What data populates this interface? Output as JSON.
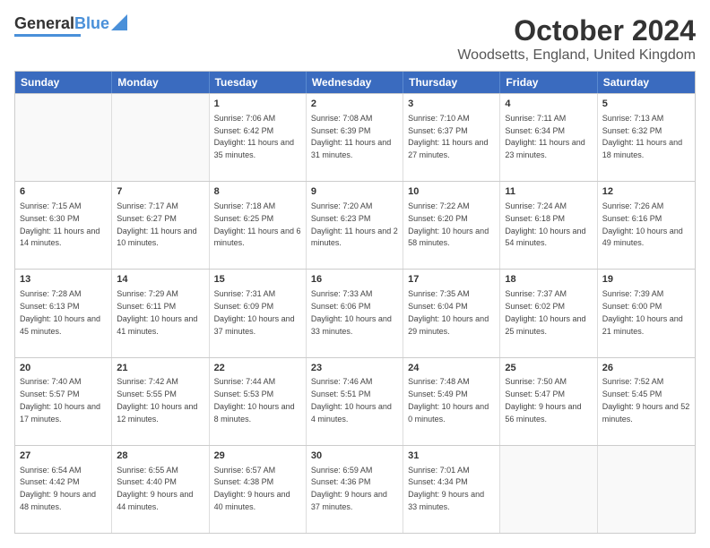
{
  "header": {
    "logo_general": "General",
    "logo_blue": "Blue",
    "title": "October 2024",
    "subtitle": "Woodsetts, England, United Kingdom"
  },
  "days_of_week": [
    "Sunday",
    "Monday",
    "Tuesday",
    "Wednesday",
    "Thursday",
    "Friday",
    "Saturday"
  ],
  "weeks": [
    [
      {
        "day": "",
        "sunrise": "",
        "sunset": "",
        "daylight": ""
      },
      {
        "day": "",
        "sunrise": "",
        "sunset": "",
        "daylight": ""
      },
      {
        "day": "1",
        "sunrise": "Sunrise: 7:06 AM",
        "sunset": "Sunset: 6:42 PM",
        "daylight": "Daylight: 11 hours and 35 minutes."
      },
      {
        "day": "2",
        "sunrise": "Sunrise: 7:08 AM",
        "sunset": "Sunset: 6:39 PM",
        "daylight": "Daylight: 11 hours and 31 minutes."
      },
      {
        "day": "3",
        "sunrise": "Sunrise: 7:10 AM",
        "sunset": "Sunset: 6:37 PM",
        "daylight": "Daylight: 11 hours and 27 minutes."
      },
      {
        "day": "4",
        "sunrise": "Sunrise: 7:11 AM",
        "sunset": "Sunset: 6:34 PM",
        "daylight": "Daylight: 11 hours and 23 minutes."
      },
      {
        "day": "5",
        "sunrise": "Sunrise: 7:13 AM",
        "sunset": "Sunset: 6:32 PM",
        "daylight": "Daylight: 11 hours and 18 minutes."
      }
    ],
    [
      {
        "day": "6",
        "sunrise": "Sunrise: 7:15 AM",
        "sunset": "Sunset: 6:30 PM",
        "daylight": "Daylight: 11 hours and 14 minutes."
      },
      {
        "day": "7",
        "sunrise": "Sunrise: 7:17 AM",
        "sunset": "Sunset: 6:27 PM",
        "daylight": "Daylight: 11 hours and 10 minutes."
      },
      {
        "day": "8",
        "sunrise": "Sunrise: 7:18 AM",
        "sunset": "Sunset: 6:25 PM",
        "daylight": "Daylight: 11 hours and 6 minutes."
      },
      {
        "day": "9",
        "sunrise": "Sunrise: 7:20 AM",
        "sunset": "Sunset: 6:23 PM",
        "daylight": "Daylight: 11 hours and 2 minutes."
      },
      {
        "day": "10",
        "sunrise": "Sunrise: 7:22 AM",
        "sunset": "Sunset: 6:20 PM",
        "daylight": "Daylight: 10 hours and 58 minutes."
      },
      {
        "day": "11",
        "sunrise": "Sunrise: 7:24 AM",
        "sunset": "Sunset: 6:18 PM",
        "daylight": "Daylight: 10 hours and 54 minutes."
      },
      {
        "day": "12",
        "sunrise": "Sunrise: 7:26 AM",
        "sunset": "Sunset: 6:16 PM",
        "daylight": "Daylight: 10 hours and 49 minutes."
      }
    ],
    [
      {
        "day": "13",
        "sunrise": "Sunrise: 7:28 AM",
        "sunset": "Sunset: 6:13 PM",
        "daylight": "Daylight: 10 hours and 45 minutes."
      },
      {
        "day": "14",
        "sunrise": "Sunrise: 7:29 AM",
        "sunset": "Sunset: 6:11 PM",
        "daylight": "Daylight: 10 hours and 41 minutes."
      },
      {
        "day": "15",
        "sunrise": "Sunrise: 7:31 AM",
        "sunset": "Sunset: 6:09 PM",
        "daylight": "Daylight: 10 hours and 37 minutes."
      },
      {
        "day": "16",
        "sunrise": "Sunrise: 7:33 AM",
        "sunset": "Sunset: 6:06 PM",
        "daylight": "Daylight: 10 hours and 33 minutes."
      },
      {
        "day": "17",
        "sunrise": "Sunrise: 7:35 AM",
        "sunset": "Sunset: 6:04 PM",
        "daylight": "Daylight: 10 hours and 29 minutes."
      },
      {
        "day": "18",
        "sunrise": "Sunrise: 7:37 AM",
        "sunset": "Sunset: 6:02 PM",
        "daylight": "Daylight: 10 hours and 25 minutes."
      },
      {
        "day": "19",
        "sunrise": "Sunrise: 7:39 AM",
        "sunset": "Sunset: 6:00 PM",
        "daylight": "Daylight: 10 hours and 21 minutes."
      }
    ],
    [
      {
        "day": "20",
        "sunrise": "Sunrise: 7:40 AM",
        "sunset": "Sunset: 5:57 PM",
        "daylight": "Daylight: 10 hours and 17 minutes."
      },
      {
        "day": "21",
        "sunrise": "Sunrise: 7:42 AM",
        "sunset": "Sunset: 5:55 PM",
        "daylight": "Daylight: 10 hours and 12 minutes."
      },
      {
        "day": "22",
        "sunrise": "Sunrise: 7:44 AM",
        "sunset": "Sunset: 5:53 PM",
        "daylight": "Daylight: 10 hours and 8 minutes."
      },
      {
        "day": "23",
        "sunrise": "Sunrise: 7:46 AM",
        "sunset": "Sunset: 5:51 PM",
        "daylight": "Daylight: 10 hours and 4 minutes."
      },
      {
        "day": "24",
        "sunrise": "Sunrise: 7:48 AM",
        "sunset": "Sunset: 5:49 PM",
        "daylight": "Daylight: 10 hours and 0 minutes."
      },
      {
        "day": "25",
        "sunrise": "Sunrise: 7:50 AM",
        "sunset": "Sunset: 5:47 PM",
        "daylight": "Daylight: 9 hours and 56 minutes."
      },
      {
        "day": "26",
        "sunrise": "Sunrise: 7:52 AM",
        "sunset": "Sunset: 5:45 PM",
        "daylight": "Daylight: 9 hours and 52 minutes."
      }
    ],
    [
      {
        "day": "27",
        "sunrise": "Sunrise: 6:54 AM",
        "sunset": "Sunset: 4:42 PM",
        "daylight": "Daylight: 9 hours and 48 minutes."
      },
      {
        "day": "28",
        "sunrise": "Sunrise: 6:55 AM",
        "sunset": "Sunset: 4:40 PM",
        "daylight": "Daylight: 9 hours and 44 minutes."
      },
      {
        "day": "29",
        "sunrise": "Sunrise: 6:57 AM",
        "sunset": "Sunset: 4:38 PM",
        "daylight": "Daylight: 9 hours and 40 minutes."
      },
      {
        "day": "30",
        "sunrise": "Sunrise: 6:59 AM",
        "sunset": "Sunset: 4:36 PM",
        "daylight": "Daylight: 9 hours and 37 minutes."
      },
      {
        "day": "31",
        "sunrise": "Sunrise: 7:01 AM",
        "sunset": "Sunset: 4:34 PM",
        "daylight": "Daylight: 9 hours and 33 minutes."
      },
      {
        "day": "",
        "sunrise": "",
        "sunset": "",
        "daylight": ""
      },
      {
        "day": "",
        "sunrise": "",
        "sunset": "",
        "daylight": ""
      }
    ]
  ]
}
